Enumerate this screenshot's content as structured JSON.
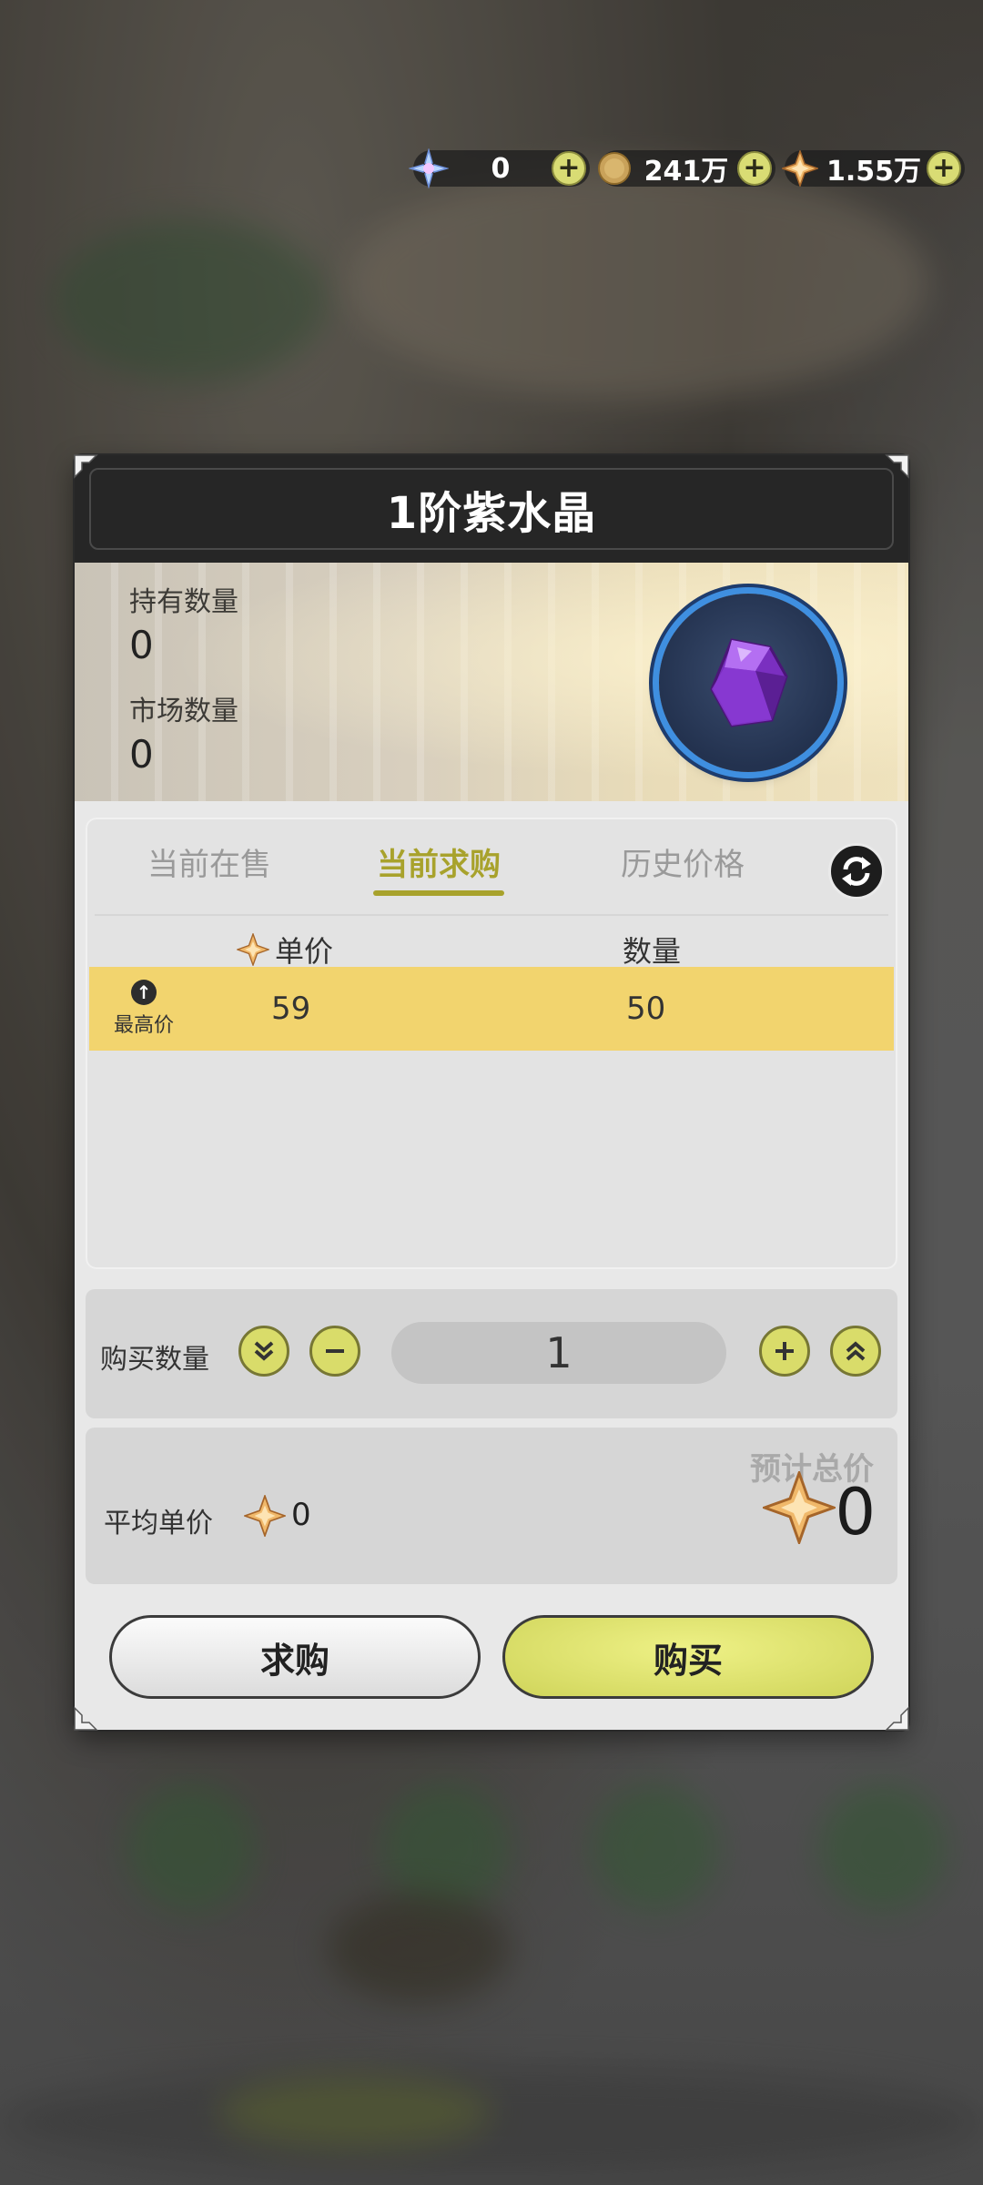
{
  "currency": [
    {
      "icon": "snowflake-crystal-icon",
      "value": "0"
    },
    {
      "icon": "gold-coin-icon",
      "value": "241万"
    },
    {
      "icon": "diamond-star-icon",
      "value": "1.55万"
    }
  ],
  "dialog": {
    "title": "1阶紫水晶",
    "held_label": "持有数量",
    "held_value": "0",
    "market_label": "市场数量",
    "market_value": "0",
    "item_icon": "purple-crystal-icon"
  },
  "tabs": [
    "当前在售",
    "当前求购",
    "历史价格"
  ],
  "active_tab": "当前求购",
  "table": {
    "col_price": "单价",
    "col_qty": "数量",
    "rows": [
      {
        "badge": "最高价",
        "price": "59",
        "qty": "50"
      }
    ]
  },
  "quantity": {
    "label": "购买数量",
    "value": "1"
  },
  "price": {
    "avg_label": "平均单价",
    "avg_value": "0",
    "total_label": "预计总价",
    "total_value": "0"
  },
  "buttons": {
    "request": "求购",
    "buy": "购买"
  },
  "colors": {
    "accent": "#a8a22c",
    "highlight_row": "#f2d46e",
    "button_green": "#d9dc6a"
  }
}
